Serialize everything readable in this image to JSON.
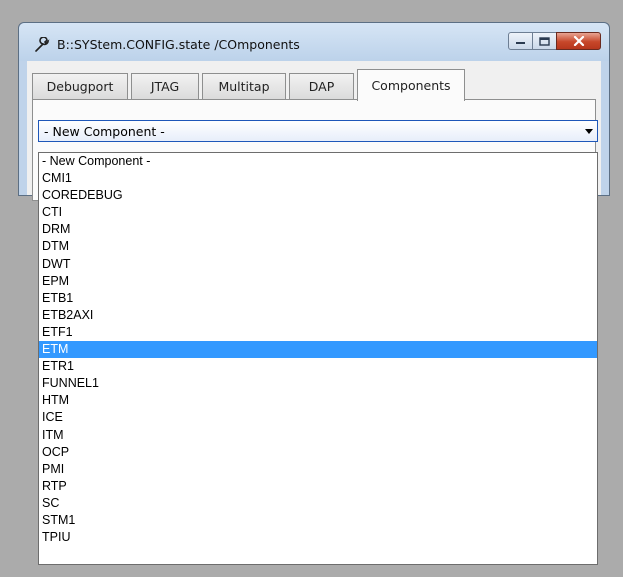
{
  "window": {
    "title": "B::SYStem.CONFIG.state /COmponents",
    "title_icon": "wrench-icon",
    "caption_buttons": [
      "minimize-icon",
      "maximize-icon",
      "close-icon"
    ]
  },
  "tabs": [
    {
      "label": "Debugport",
      "active": false
    },
    {
      "label": "JTAG",
      "active": false
    },
    {
      "label": "Multitap",
      "active": false
    },
    {
      "label": "DAP",
      "active": false
    },
    {
      "label": "Components",
      "active": true
    }
  ],
  "combo": {
    "value": "- New Component -",
    "arrow_icon": "chevron-down-icon"
  },
  "dropdown": {
    "options": [
      "- New Component -",
      "CMI1",
      "COREDEBUG",
      "CTI",
      "DRM",
      "DTM",
      "DWT",
      "EPM",
      "ETB1",
      "ETB2AXI",
      "ETF1",
      "ETM",
      "ETR1",
      "FUNNEL1",
      "HTM",
      "ICE",
      "ITM",
      "OCP",
      "PMI",
      "RTP",
      "SC",
      "STM1",
      "TPIU"
    ],
    "highlighted": "ETM"
  },
  "colors": {
    "highlight": "#3399ff",
    "close_button": "#c7472a",
    "titlebar": "#bcd2ea"
  }
}
